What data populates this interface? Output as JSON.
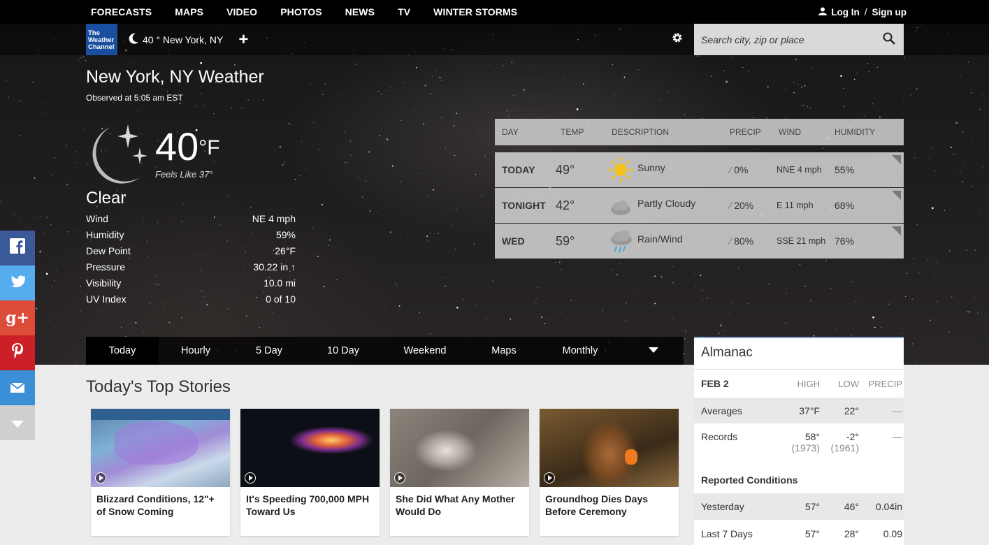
{
  "nav": {
    "links": [
      "FORECASTS",
      "MAPS",
      "VIDEO",
      "PHOTOS",
      "NEWS",
      "TV",
      "WINTER STORMS"
    ],
    "login": "Log In",
    "signup": "Sign up",
    "separator": "/"
  },
  "header": {
    "logo_text": "The Weather Channel",
    "current_location": "40 ° New York, NY",
    "add_label": "+",
    "search_placeholder": "Search city, zip or place"
  },
  "current": {
    "title": "New York, NY Weather",
    "observed": "Observed at 5:05 am EST",
    "temp": "40",
    "unit": "°F",
    "feels_like": "Feels Like 37°",
    "condition": "Clear",
    "details": [
      {
        "label": "Wind",
        "value": "NE 4 mph"
      },
      {
        "label": "Humidity",
        "value": "59%"
      },
      {
        "label": "Dew Point",
        "value": "26°F"
      },
      {
        "label": "Pressure",
        "value": "30.22 in ↑"
      },
      {
        "label": "Visibility",
        "value": "10.0 mi"
      },
      {
        "label": "UV Index",
        "value": "0 of 10"
      }
    ]
  },
  "forecast": {
    "headers": [
      "DAY",
      "TEMP",
      "DESCRIPTION",
      "PRECIP",
      "WIND",
      "HUMIDITY"
    ],
    "rows": [
      {
        "day": "TODAY",
        "temp": "49°",
        "desc": "Sunny",
        "icon": "sun-icon",
        "precip": "0%",
        "wind": "NNE 4 mph",
        "humidity": "55%"
      },
      {
        "day": "TONIGHT",
        "temp": "42°",
        "desc": "Partly Cloudy",
        "icon": "partly-cloudy-night-icon",
        "precip": "20%",
        "wind": "E 11 mph",
        "humidity": "68%"
      },
      {
        "day": "WED",
        "temp": "59°",
        "desc": "Rain/Wind",
        "icon": "rain-icon",
        "precip": "80%",
        "wind": "SSE 21 mph",
        "humidity": "76%"
      }
    ]
  },
  "tabs": [
    "Today",
    "Hourly",
    "5 Day",
    "10 Day",
    "Weekend",
    "Maps",
    "Monthly"
  ],
  "stories": {
    "title": "Today's Top Stories",
    "items": [
      {
        "headline": "Blizzard Conditions, 12\"+ of Snow Coming"
      },
      {
        "headline": "It's Speeding 700,000 MPH Toward Us"
      },
      {
        "headline": "She Did What Any Mother Would Do"
      },
      {
        "headline": "Groundhog Dies Days Before Ceremony"
      }
    ]
  },
  "almanac": {
    "title": "Almanac",
    "date": "FEB 2",
    "headers": [
      "HIGH",
      "LOW",
      "PRECIP"
    ],
    "averages": {
      "label": "Averages",
      "high": "37°F",
      "low": "22°",
      "precip": "—"
    },
    "records": {
      "label": "Records",
      "high": "58°",
      "high_year": "(1973)",
      "low": "-2°",
      "low_year": "(1961)",
      "precip": "—"
    },
    "reported_title": "Reported Conditions",
    "yesterday": {
      "label": "Yesterday",
      "high": "57°",
      "low": "46°",
      "precip": "0.04in"
    },
    "last7": {
      "label": "Last 7 Days",
      "high": "57°",
      "low": "28°",
      "precip": "0.09"
    }
  },
  "social": [
    "f",
    "t",
    "g+",
    "p",
    "mail",
    "more"
  ],
  "colors": {
    "facebook": "#3b5998",
    "twitter": "#55acee",
    "googleplus": "#dd4b39",
    "pinterest": "#cb2027",
    "email": "#3a8fd6",
    "more": "#cfcfcf",
    "logo": "#1a4fa0"
  }
}
